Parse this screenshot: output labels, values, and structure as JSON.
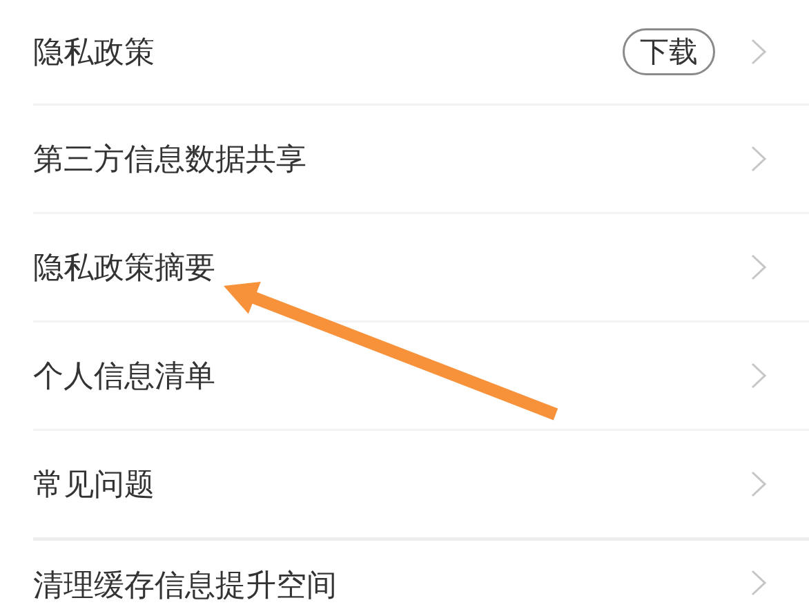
{
  "groups": [
    {
      "items": [
        {
          "label": "隐私政策",
          "action": "下载"
        },
        {
          "label": "第三方信息数据共享"
        },
        {
          "label": "隐私政策摘要"
        },
        {
          "label": "个人信息清单"
        },
        {
          "label": "常见问题"
        }
      ]
    },
    {
      "items": [
        {
          "label": "清理缓存信息提升空间"
        }
      ]
    }
  ]
}
